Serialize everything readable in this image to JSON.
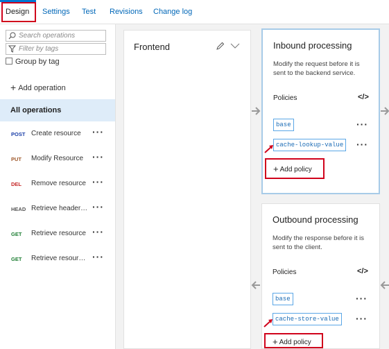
{
  "tabs": [
    "Design",
    "Settings",
    "Test",
    "Revisions",
    "Change log"
  ],
  "left_panel": {
    "search_placeholder": "Search operations",
    "filter_placeholder": "Filter by tags",
    "group_by_tag": "Group by tag",
    "add_operation": "Add operation",
    "all_operations": "All operations",
    "operations": [
      {
        "verb": "POST",
        "name": "Create resource",
        "color": "#1b3fa8"
      },
      {
        "verb": "PUT",
        "name": "Modify Resource",
        "color": "#a05a2c"
      },
      {
        "verb": "DEL",
        "name": "Remove resource",
        "color": "#c62828"
      },
      {
        "verb": "HEAD",
        "name": "Retrieve header o...",
        "color": "#555555"
      },
      {
        "verb": "GET",
        "name": "Retrieve resource",
        "color": "#1e7e34"
      },
      {
        "verb": "GET",
        "name": "Retrieve resource...",
        "color": "#1e7e34"
      }
    ]
  },
  "frontend": {
    "title": "Frontend"
  },
  "inbound": {
    "title": "Inbound processing",
    "description": "Modify the request before it is sent to the backend service.",
    "policies_label": "Policies",
    "code_icon": "</>",
    "policies": [
      "base",
      "cache-lookup-value"
    ],
    "add_policy": "Add policy"
  },
  "outbound": {
    "title": "Outbound processing",
    "description": "Modify the response before it is sent to the client.",
    "policies_label": "Policies",
    "code_icon": "</>",
    "policies": [
      "base",
      "cache-store-value"
    ],
    "add_policy": "Add policy"
  },
  "colors": {
    "accent": "#0078d4",
    "highlight": "#d0021b",
    "chip_border": "#5aa6e6",
    "selected_bg": "#deecf9"
  }
}
